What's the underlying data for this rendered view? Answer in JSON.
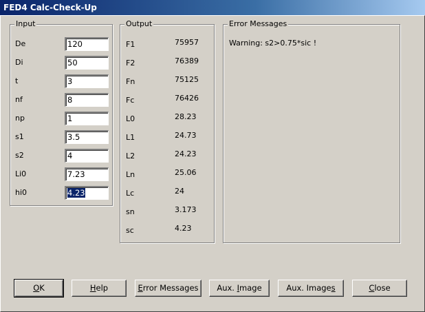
{
  "window": {
    "title": "FED4   Calc-Check-Up"
  },
  "input": {
    "title": "Input",
    "fields": [
      {
        "label": "De",
        "value": "120"
      },
      {
        "label": "Di",
        "value": "50"
      },
      {
        "label": "t",
        "value": "3"
      },
      {
        "label": "nf",
        "value": "8"
      },
      {
        "label": "np",
        "value": "1"
      },
      {
        "label": "s1",
        "value": "3.5"
      },
      {
        "label": "s2",
        "value": "4"
      },
      {
        "label": "Li0",
        "value": "7.23"
      },
      {
        "label": "hi0",
        "value": "4.23"
      }
    ]
  },
  "output": {
    "title": "Output",
    "rows": [
      {
        "label": "F1",
        "value": "75957"
      },
      {
        "label": "F2",
        "value": "76389"
      },
      {
        "label": "Fn",
        "value": "75125"
      },
      {
        "label": "Fc",
        "value": "76426"
      },
      {
        "label": "L0",
        "value": "28.23"
      },
      {
        "label": "L1",
        "value": "24.73"
      },
      {
        "label": "L2",
        "value": "24.23"
      },
      {
        "label": "Ln",
        "value": "25.06"
      },
      {
        "label": "Lc",
        "value": "24"
      },
      {
        "label": "sn",
        "value": "3.173"
      },
      {
        "label": "sc",
        "value": "4.23"
      }
    ]
  },
  "errors": {
    "title": "Error Messages",
    "message": "Warning: s2>0.75*sic !"
  },
  "buttons": {
    "ok": {
      "pre": "",
      "key": "O",
      "post": "K"
    },
    "help": {
      "pre": "",
      "key": "H",
      "post": "elp"
    },
    "error_messages": {
      "pre": "",
      "key": "E",
      "post": "rror Messages"
    },
    "aux_image": {
      "pre": "Aux. ",
      "key": "I",
      "post": "mage"
    },
    "aux_images": {
      "pre": "Aux. Image",
      "key": "s",
      "post": ""
    },
    "close": {
      "pre": "",
      "key": "C",
      "post": "lose"
    }
  }
}
